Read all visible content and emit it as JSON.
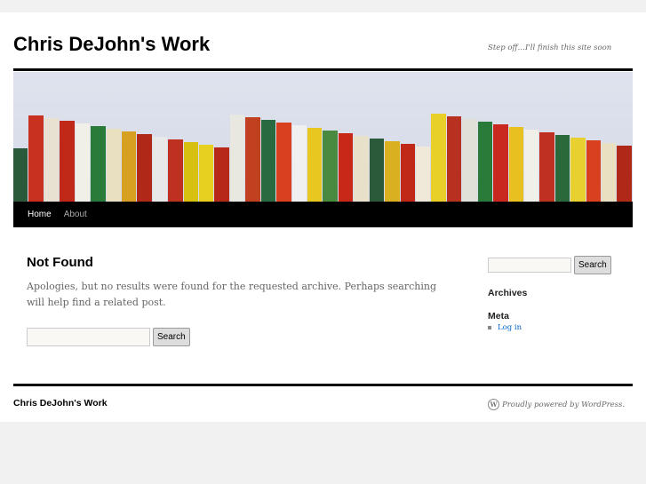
{
  "header": {
    "site_title": "Chris DeJohn's Work",
    "description": "Step off…I'll finish this site soon"
  },
  "banner": {
    "book_colors": [
      "#2a5a3a",
      "#c83020",
      "#e8e0d0",
      "#c02818",
      "#f0f0e8",
      "#2a7a3a",
      "#e8e0c0",
      "#d8a020",
      "#b02818",
      "#e8e8e8",
      "#c03020",
      "#d8c010",
      "#e8d020",
      "#b82818",
      "#e8e8e0",
      "#c04020",
      "#2a6a40",
      "#d84020",
      "#f0f0f0",
      "#e8c820",
      "#4a8a40",
      "#c82818",
      "#e8e0c8",
      "#2a5a3a",
      "#d8b020",
      "#c02818",
      "#f0e8d8",
      "#e8d028",
      "#b83020",
      "#e0e0d8",
      "#2a7a3a",
      "#c82820",
      "#e8c020",
      "#f0f0e8",
      "#c03020",
      "#2a6a3a",
      "#e8d030",
      "#d84020",
      "#e8e0c0",
      "#b02818"
    ]
  },
  "nav": {
    "items": [
      {
        "label": "Home"
      },
      {
        "label": "About"
      }
    ]
  },
  "main": {
    "title": "Not Found",
    "message": "Apologies, but no results were found for the requested archive. Perhaps searching will help find a related post.",
    "search_placeholder": "",
    "search_button": "Search"
  },
  "sidebar": {
    "search_placeholder": "",
    "search_button": "Search",
    "archives_heading": "Archives",
    "meta_heading": "Meta",
    "meta_links": [
      {
        "label": "Log in"
      }
    ]
  },
  "footer": {
    "site_title": "Chris DeJohn's Work",
    "powered": "Proudly powered by WordPress."
  }
}
